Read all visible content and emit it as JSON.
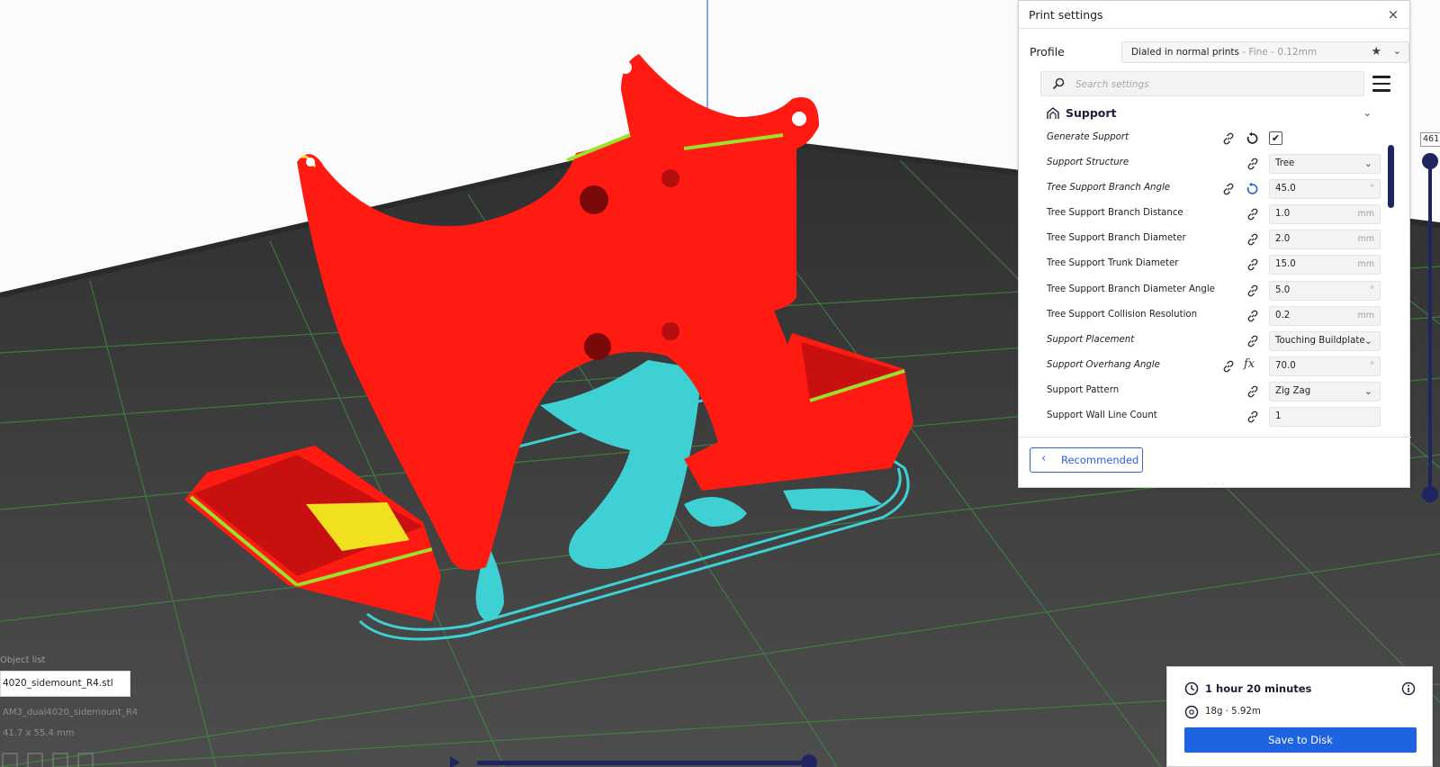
{
  "print_settings": {
    "title": "Print settings",
    "close_glyph": "×",
    "profile": {
      "label": "Profile",
      "name": "Dialed in normal prints",
      "sub": " - Fine - 0.12mm"
    },
    "search": {
      "placeholder": "Search settings"
    },
    "section": {
      "title": "Support"
    },
    "settings": [
      {
        "label": "Generate Support",
        "italic": true,
        "link": true,
        "reset": true,
        "reset_color": "#222222",
        "type": "checkbox",
        "checked": true,
        "value": "",
        "unit": ""
      },
      {
        "label": "Support Structure",
        "italic": true,
        "link": true,
        "type": "combo",
        "value": "Tree",
        "unit": ""
      },
      {
        "label": "Tree Support Branch Angle",
        "italic": true,
        "link": true,
        "reset": true,
        "reset_color": "#2a66d6",
        "type": "field",
        "value": "45.0",
        "unit": "°"
      },
      {
        "label": "Tree Support Branch Distance",
        "italic": false,
        "link": true,
        "type": "field",
        "value": "1.0",
        "unit": "mm"
      },
      {
        "label": "Tree Support Branch Diameter",
        "italic": false,
        "link": true,
        "type": "field",
        "value": "2.0",
        "unit": "mm"
      },
      {
        "label": "Tree Support Trunk Diameter",
        "italic": false,
        "link": true,
        "type": "field",
        "value": "15.0",
        "unit": "mm"
      },
      {
        "label": "Tree Support Branch Diameter Angle",
        "italic": false,
        "link": true,
        "type": "field",
        "value": "5.0",
        "unit": "°"
      },
      {
        "label": "Tree Support Collision Resolution",
        "italic": false,
        "link": true,
        "type": "field",
        "value": "0.2",
        "unit": "mm"
      },
      {
        "label": "Support Placement",
        "italic": true,
        "link": true,
        "type": "combo",
        "value": "Touching Buildplate",
        "unit": ""
      },
      {
        "label": "Support Overhang Angle",
        "italic": true,
        "link": true,
        "fx": true,
        "type": "field",
        "value": "70.0",
        "unit": "°"
      },
      {
        "label": "Support Pattern",
        "italic": false,
        "link": true,
        "type": "combo",
        "value": "Zig Zag",
        "unit": ""
      },
      {
        "label": "Support Wall Line Count",
        "italic": false,
        "link": true,
        "type": "field",
        "value": "1",
        "unit": ""
      }
    ],
    "recommended_label": "Recommended"
  },
  "job": {
    "time": "1 hour 20 minutes",
    "material": "18g · 5.92m",
    "save_label": "Save to Disk"
  },
  "object_list": {
    "title": "Object list",
    "file": "4020_sidemount_R4.stl",
    "object_name": "AM3_dual4020_sidemount_R4",
    "dims": "41.7 x 55.4 mm"
  },
  "layer_slider": {
    "value": "461"
  },
  "colors": {
    "accent": "#1e63e0",
    "slider": "#1f2560",
    "model_red": "#ff1a12",
    "support_cyan": "#3fd0d4",
    "plate": "#3c3c3c",
    "grid": "#3f8f3f"
  }
}
